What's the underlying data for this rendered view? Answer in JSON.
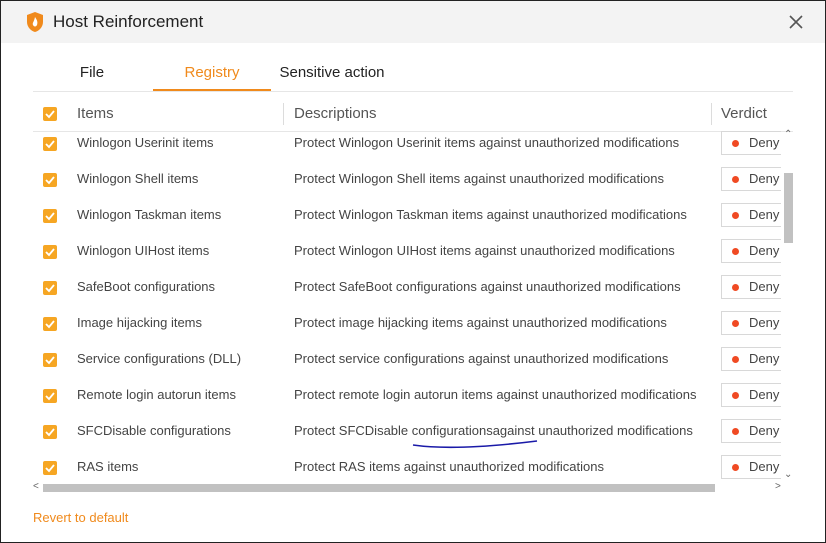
{
  "window": {
    "title": "Host Reinforcement",
    "icon": "flame-shield-icon",
    "close_icon": "close-icon"
  },
  "tabs": [
    {
      "label": "File",
      "active": false
    },
    {
      "label": "Registry",
      "active": true
    },
    {
      "label": "Sensitive action",
      "active": false
    }
  ],
  "table": {
    "headers": {
      "items": "Items",
      "descriptions": "Descriptions",
      "verdict": "Verdict"
    },
    "select_all_checked": true,
    "rows": [
      {
        "checked": true,
        "item": "Winlogon Userinit items",
        "description": "Protect Winlogon Userinit items against unauthorized modifications",
        "verdict": "Deny"
      },
      {
        "checked": true,
        "item": "Winlogon Shell items",
        "description": "Protect Winlogon Shell items against unauthorized modifications",
        "verdict": "Deny"
      },
      {
        "checked": true,
        "item": "Winlogon Taskman items",
        "description": "Protect Winlogon Taskman items against unauthorized modifications",
        "verdict": "Deny"
      },
      {
        "checked": true,
        "item": "Winlogon UIHost items",
        "description": "Protect Winlogon UIHost items against unauthorized modifications",
        "verdict": "Deny"
      },
      {
        "checked": true,
        "item": "SafeBoot configurations",
        "description": "Protect SafeBoot configurations against unauthorized modifications",
        "verdict": "Deny"
      },
      {
        "checked": true,
        "item": "Image hijacking items",
        "description": "Protect image hijacking items against unauthorized modifications",
        "verdict": "Deny"
      },
      {
        "checked": true,
        "item": "Service configurations (DLL)",
        "description": "Protect service configurations against unauthorized modifications",
        "verdict": "Deny"
      },
      {
        "checked": true,
        "item": "Remote login autorun items",
        "description": "Protect remote login autorun items against unauthorized modifications",
        "verdict": "Deny"
      },
      {
        "checked": true,
        "item": "SFCDisable configurations",
        "description": "Protect SFCDisable configurationsagainst unauthorized modifications",
        "verdict": "Deny"
      },
      {
        "checked": true,
        "item": "RAS items",
        "description": "Protect RAS items against unauthorized modifications",
        "verdict": "Deny"
      }
    ]
  },
  "footer": {
    "revert_label": "Revert to default"
  },
  "colors": {
    "accent": "#f08a1c",
    "checkbox": "#f6a623",
    "deny_dot": "#f04a23",
    "annotation": "#1a1aa8"
  }
}
